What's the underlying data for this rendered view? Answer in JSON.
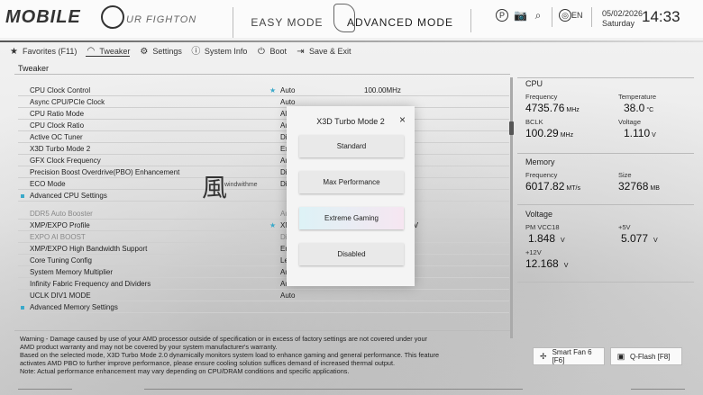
{
  "header": {
    "brand": "MOBILE",
    "slogan": "UR FIGHTON",
    "modes": {
      "easy": "EASY MODE",
      "advanced": "ADVANCED MODE"
    },
    "language": "EN",
    "date": "05/02/2026",
    "weekday": "Saturday",
    "time": "14:33"
  },
  "nav": {
    "items": [
      {
        "label": "Favorites (F11)",
        "icon": "star-folder-icon"
      },
      {
        "label": "Tweaker",
        "icon": "gauge-icon"
      },
      {
        "label": "Settings",
        "icon": "gear-icon"
      },
      {
        "label": "System Info",
        "icon": "info-icon"
      },
      {
        "label": "Boot",
        "icon": "power-icon"
      },
      {
        "label": "Save & Exit",
        "icon": "exit-icon"
      }
    ],
    "active": "Tweaker"
  },
  "breadcrumb": "Tweaker",
  "settings": {
    "rows": [
      {
        "label": "CPU Clock Control",
        "value": "Auto",
        "extra": "100.00MHz",
        "starred": true
      },
      {
        "label": "Async CPU/PCIe Clock",
        "value": "Auto"
      },
      {
        "label": "CPU Ratio Mode",
        "value": "All"
      },
      {
        "label": "CPU Clock Ratio",
        "value": "Auto"
      },
      {
        "label": "Active OC Tuner",
        "value": "Di"
      },
      {
        "label": "X3D Turbo Mode 2",
        "value": "Ex"
      },
      {
        "label": "GFX Clock Frequency",
        "value": "Au"
      },
      {
        "label": "Precision Boost Overdrive(PBO) Enhancement",
        "value": "Di"
      },
      {
        "label": "ECO Mode",
        "value": "Di"
      },
      {
        "label": "Advanced CPU Settings",
        "section": true
      },
      {
        "label": "DDR5 Auto Booster",
        "value": "Au",
        "gray": true,
        "spaced": true
      },
      {
        "label": "XMP/EXPO Profile",
        "value": "XM",
        "extra": "36-36-76-1.350V",
        "starred": true
      },
      {
        "label": "EXPO AI BOOST",
        "value": "Di",
        "gray": true
      },
      {
        "label": "XMP/EXPO High Bandwidth Support",
        "value": "En"
      },
      {
        "label": "Core Tuning Config",
        "value": "Le"
      },
      {
        "label": "System Memory Multiplier",
        "value": "Au"
      },
      {
        "label": "Infinity Fabric Frequency and Dividers",
        "value": "Auto"
      },
      {
        "label": "UCLK DIV1 MODE",
        "value": "Auto"
      },
      {
        "label": "Advanced Memory Settings",
        "section": true
      }
    ]
  },
  "watermark": {
    "glyph": "風",
    "text": "windwithme"
  },
  "modal": {
    "title": "X3D Turbo Mode 2",
    "close": "×",
    "options": [
      "Standard",
      "Max Performance",
      "Extreme Gaming",
      "Disabled"
    ],
    "selected": "Extreme Gaming"
  },
  "panel": {
    "cpu": {
      "title": "CPU",
      "frequency_label": "Frequency",
      "frequency": "4735.76",
      "frequency_unit": "MHz",
      "temperature_label": "Temperature",
      "temperature": "38.0",
      "temperature_unit": "°C",
      "bclk_label": "BCLK",
      "bclk": "100.29",
      "bclk_unit": "MHz",
      "voltage_label": "Voltage",
      "voltage": "1.110",
      "voltage_unit": "V"
    },
    "memory": {
      "title": "Memory",
      "frequency_label": "Frequency",
      "frequency": "6017.82",
      "frequency_unit": "MT/s",
      "size_label": "Size",
      "size": "32768",
      "size_unit": "MB"
    },
    "voltage": {
      "title": "Voltage",
      "pm_label": "PM VCC18",
      "pm": "1.848",
      "pm_unit": "V",
      "p5_label": "+5V",
      "p5": "5.077",
      "p5_unit": "V",
      "p12_label": "+12V",
      "p12": "12.168",
      "p12_unit": "V"
    }
  },
  "warning": {
    "line1": "Warning - Damage caused by use of your AMD processor outside of specification or in excess of factory settings are not covered under your",
    "line2": "AMD product warranty and may not be covered by your system manufacturer's warranty.",
    "line3": "Based on the selected mode, X3D Turbo Mode 2.0 dynamically monitors system load to enhance gaming and general performance. This feature",
    "line4": "activates AMD PBO to further improve performance, please ensure cooling solution suffices demand of increased thermal output.",
    "line5": "Note: Actual performance enhancement may vary depending on CPU/DRAM conditions and specific applications."
  },
  "buttons": {
    "smartfan": "Smart Fan 6 [F6]",
    "qflash": "Q-Flash [F8]"
  },
  "colors": {
    "accent": "#3aa9c9"
  }
}
